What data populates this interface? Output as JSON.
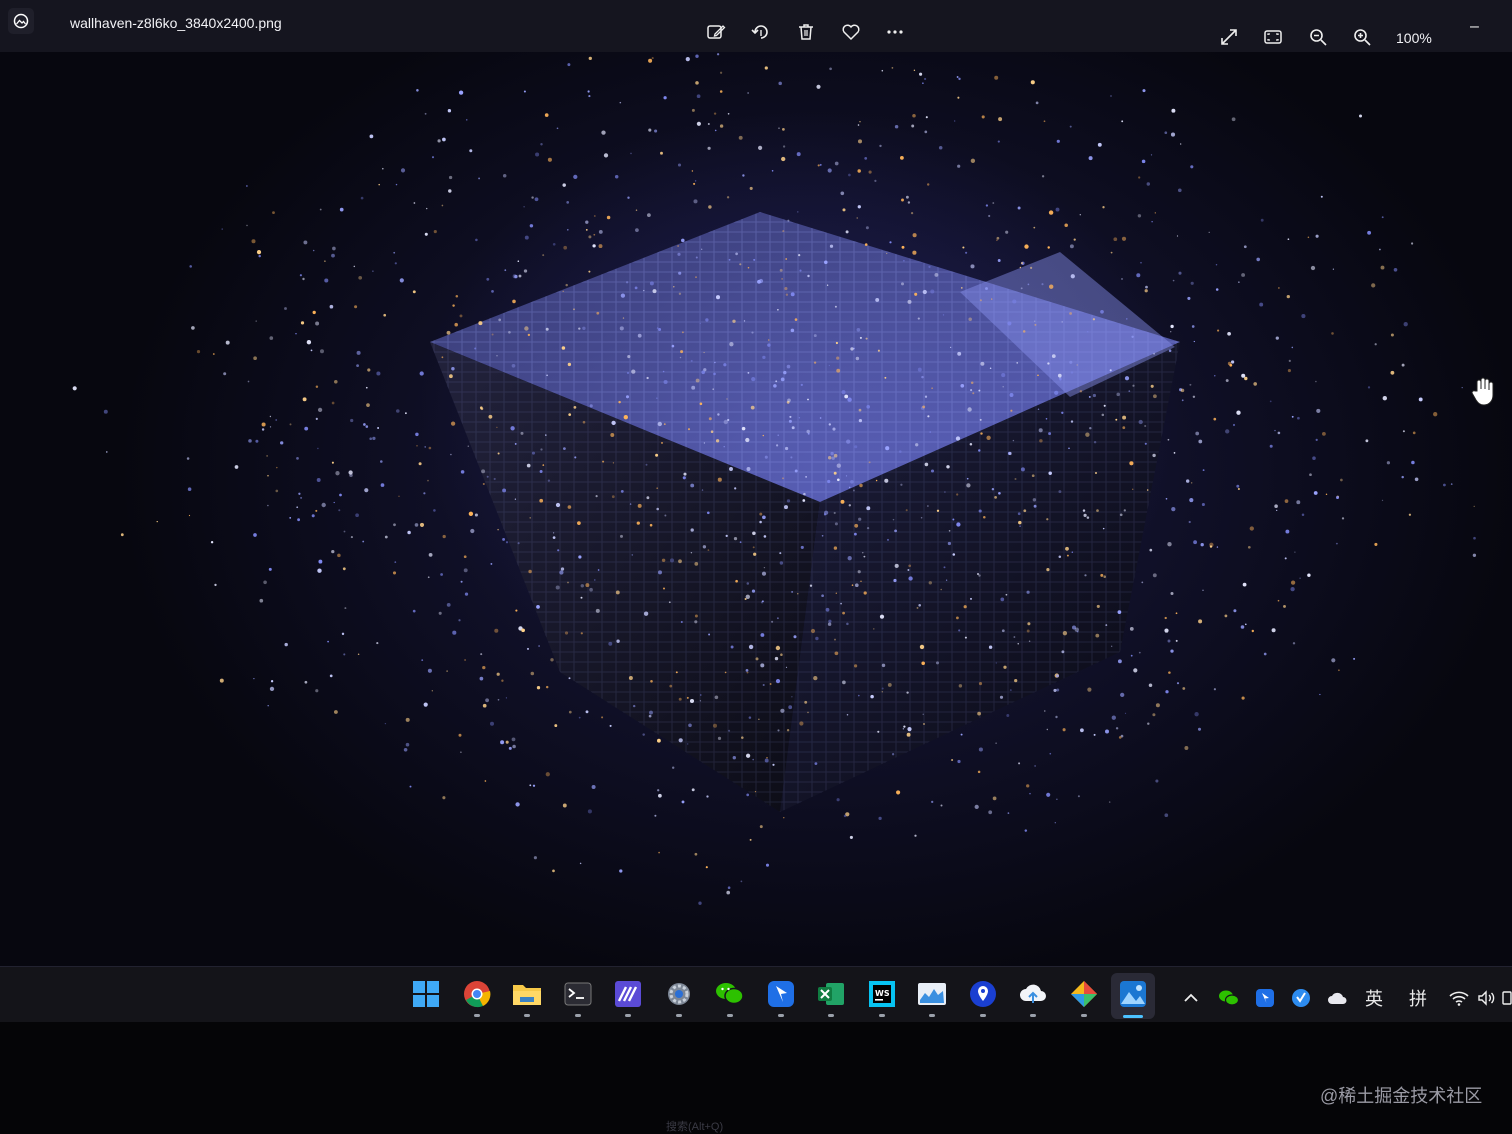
{
  "titlebar": {
    "file_name": "wallhaven-z8l6ko_3840x2400.png",
    "zoom_level": "100%",
    "tools": [
      "edit-icon",
      "rotate-icon",
      "delete-icon",
      "favorite-icon",
      "more-icon"
    ],
    "view_tools": [
      "fullscreen-icon",
      "fit-window-icon",
      "zoom-out-icon",
      "zoom-in-icon"
    ],
    "minimize_label": "–"
  },
  "taskbar": {
    "apps": [
      "start",
      "chrome",
      "file-explorer",
      "terminal",
      "visual-studio",
      "settings",
      "wechat",
      "lark",
      "excel",
      "webstorm",
      "task-manager",
      "maps",
      "cloud-drive",
      "sketch-app",
      "photos"
    ],
    "active_app": "photos",
    "tray": {
      "ime_lang": "英",
      "ime_mode": "拼"
    }
  },
  "watermark": "@稀土掘金技术社区",
  "search_hint": "搜索(Alt+Q)",
  "colors": {
    "accent": "#4cc2ff",
    "titlebar_bg": "#15151f",
    "taskbar_bg": "#141419"
  }
}
